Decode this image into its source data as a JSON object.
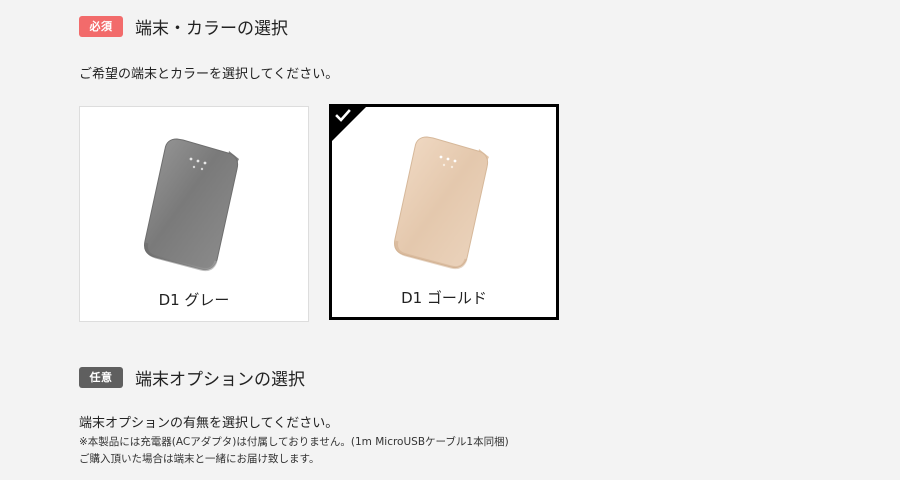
{
  "section1": {
    "badge": "必須",
    "badge_color": "#f26b6b",
    "title": "端末・カラーの選択",
    "lead": "ご希望の端末とカラーを選択してください。"
  },
  "devices": [
    {
      "name": "D1 グレー",
      "color": "gray",
      "selected": false
    },
    {
      "name": "D1 ゴールド",
      "color": "gold",
      "selected": true
    }
  ],
  "check_icon": "checkmark-icon",
  "section2": {
    "badge": "任意",
    "badge_color": "#5f5f5f",
    "title": "端末オプションの選択",
    "lead": "端末オプションの有無を選択してください。",
    "note1": "※本製品には充電器(ACアダプタ)は付属しておりません。(1m MicroUSBケーブル1本同梱)",
    "note2": "ご購入頂いた場合は端末と一緒にお届け致します。"
  }
}
